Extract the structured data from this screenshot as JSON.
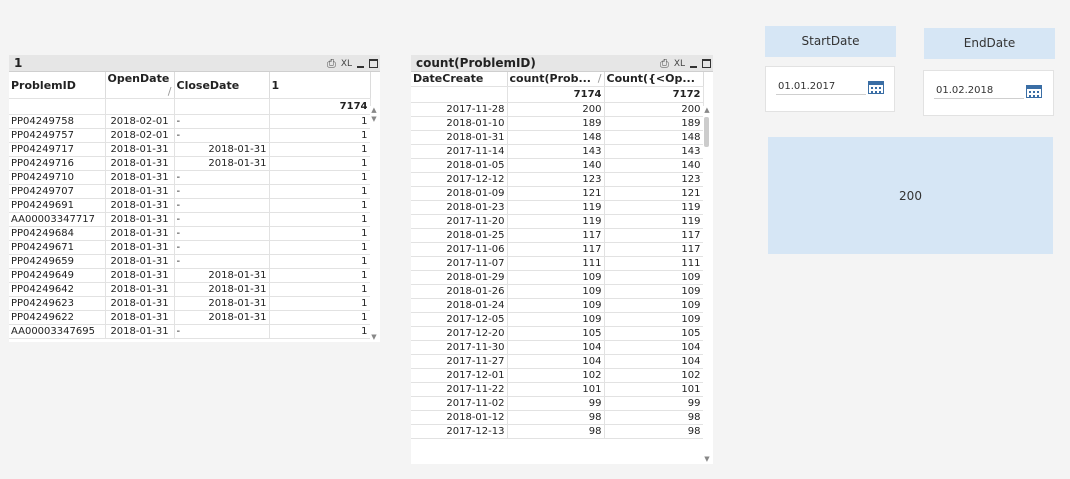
{
  "left_table": {
    "title": "1",
    "icons": [
      "print-icon",
      "xl-icon",
      "minimize-icon",
      "maximize-icon"
    ],
    "xl_label": "XL",
    "columns": [
      "ProblemID",
      "OpenDate",
      "CloseDate",
      "1"
    ],
    "total": "7174",
    "rows": [
      [
        "PP04249758",
        "2018-02-01",
        "-",
        "",
        "1"
      ],
      [
        "PP04249757",
        "2018-02-01",
        "-",
        "",
        "1"
      ],
      [
        "PP04249717",
        "2018-01-31",
        "",
        "2018-01-31",
        "1"
      ],
      [
        "PP04249716",
        "2018-01-31",
        "",
        "2018-01-31",
        "1"
      ],
      [
        "PP04249710",
        "2018-01-31",
        "-",
        "",
        "1"
      ],
      [
        "PP04249707",
        "2018-01-31",
        "-",
        "",
        "1"
      ],
      [
        "PP04249691",
        "2018-01-31",
        "-",
        "",
        "1"
      ],
      [
        "AA00003347717",
        "2018-01-31",
        "-",
        "",
        "1"
      ],
      [
        "PP04249684",
        "2018-01-31",
        "-",
        "",
        "1"
      ],
      [
        "PP04249671",
        "2018-01-31",
        "-",
        "",
        "1"
      ],
      [
        "PP04249659",
        "2018-01-31",
        "-",
        "",
        "1"
      ],
      [
        "PP04249649",
        "2018-01-31",
        "",
        "2018-01-31",
        "1"
      ],
      [
        "PP04249642",
        "2018-01-31",
        "",
        "2018-01-31",
        "1"
      ],
      [
        "PP04249623",
        "2018-01-31",
        "",
        "2018-01-31",
        "1"
      ],
      [
        "PP04249622",
        "2018-01-31",
        "",
        "2018-01-31",
        "1"
      ],
      [
        "AA00003347695",
        "2018-01-31",
        "-",
        "",
        "1"
      ]
    ]
  },
  "right_table": {
    "title": "count(ProblemID)",
    "xl_label": "XL",
    "columns": [
      "DateCreate",
      "count(Prob...",
      "Count({<Op..."
    ],
    "totals": [
      "7174",
      "7172"
    ],
    "rows": [
      [
        "2017-11-28",
        "200",
        "200"
      ],
      [
        "2018-01-10",
        "189",
        "189"
      ],
      [
        "2018-01-31",
        "148",
        "148"
      ],
      [
        "2017-11-14",
        "143",
        "143"
      ],
      [
        "2018-01-05",
        "140",
        "140"
      ],
      [
        "2017-12-12",
        "123",
        "123"
      ],
      [
        "2018-01-09",
        "121",
        "121"
      ],
      [
        "2018-01-23",
        "119",
        "119"
      ],
      [
        "2017-11-20",
        "119",
        "119"
      ],
      [
        "2018-01-25",
        "117",
        "117"
      ],
      [
        "2017-11-06",
        "117",
        "117"
      ],
      [
        "2017-11-07",
        "111",
        "111"
      ],
      [
        "2018-01-29",
        "109",
        "109"
      ],
      [
        "2018-01-26",
        "109",
        "109"
      ],
      [
        "2018-01-24",
        "109",
        "109"
      ],
      [
        "2017-12-05",
        "109",
        "109"
      ],
      [
        "2017-12-20",
        "105",
        "105"
      ],
      [
        "2017-11-30",
        "104",
        "104"
      ],
      [
        "2017-11-27",
        "104",
        "104"
      ],
      [
        "2017-12-01",
        "102",
        "102"
      ],
      [
        "2017-11-22",
        "101",
        "101"
      ],
      [
        "2017-11-02",
        "99",
        "99"
      ],
      [
        "2018-01-12",
        "98",
        "98"
      ],
      [
        "2017-12-13",
        "98",
        "98"
      ]
    ]
  },
  "start_date": {
    "label": "StartDate",
    "value": "01.01.2017"
  },
  "end_date": {
    "label": "EndDate",
    "value": "01.02.2018"
  },
  "result": {
    "value": "200"
  },
  "colors": {
    "label_bg": "#d6e6f5",
    "caption_bg": "#e6e6e6",
    "calendar": "#3a6ea5"
  }
}
